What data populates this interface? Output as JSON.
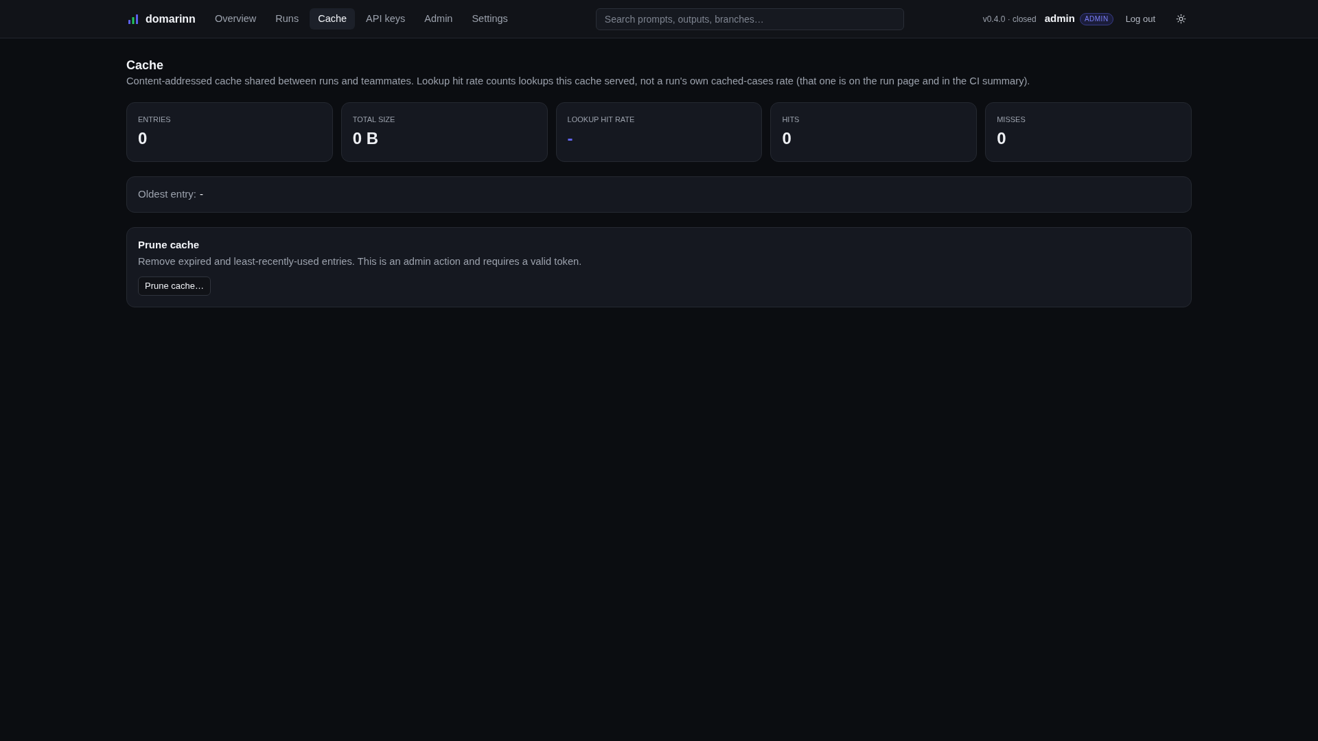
{
  "app": {
    "name": "domarinn"
  },
  "nav": [
    {
      "label": "Overview",
      "selected": false
    },
    {
      "label": "Runs",
      "selected": false
    },
    {
      "label": "Cache",
      "selected": true
    },
    {
      "label": "API keys",
      "selected": false
    },
    {
      "label": "Admin",
      "selected": false
    },
    {
      "label": "Settings",
      "selected": false
    }
  ],
  "search": {
    "placeholder": "Search prompts, outputs, branches…"
  },
  "status": "v0.4.0 · closed",
  "user": {
    "name": "admin",
    "role_badge": "ADMIN"
  },
  "logout": "Log out",
  "page": {
    "title": "Cache",
    "description": "Content-addressed cache shared between runs and teammates. Lookup hit rate counts lookups this cache served, not a run's own cached-cases rate (that one is on the run page and in the CI summary)."
  },
  "stats": [
    {
      "label": "ENTRIES",
      "value": "0",
      "kind": "count"
    },
    {
      "label": "TOTAL SIZE",
      "value": "0 B",
      "kind": "count"
    },
    {
      "label": "LOOKUP HIT RATE",
      "value": "-",
      "kind": "rate"
    },
    {
      "label": "HITS",
      "value": "0",
      "kind": "count"
    },
    {
      "label": "MISSES",
      "value": "0",
      "kind": "count"
    }
  ],
  "oldest_entry": {
    "label": "Oldest entry:",
    "value": "-"
  },
  "prune": {
    "title": "Prune cache",
    "description": "Remove expired and least-recently-used entries. This is an admin action and requires a valid token.",
    "button": "Prune cache…"
  }
}
